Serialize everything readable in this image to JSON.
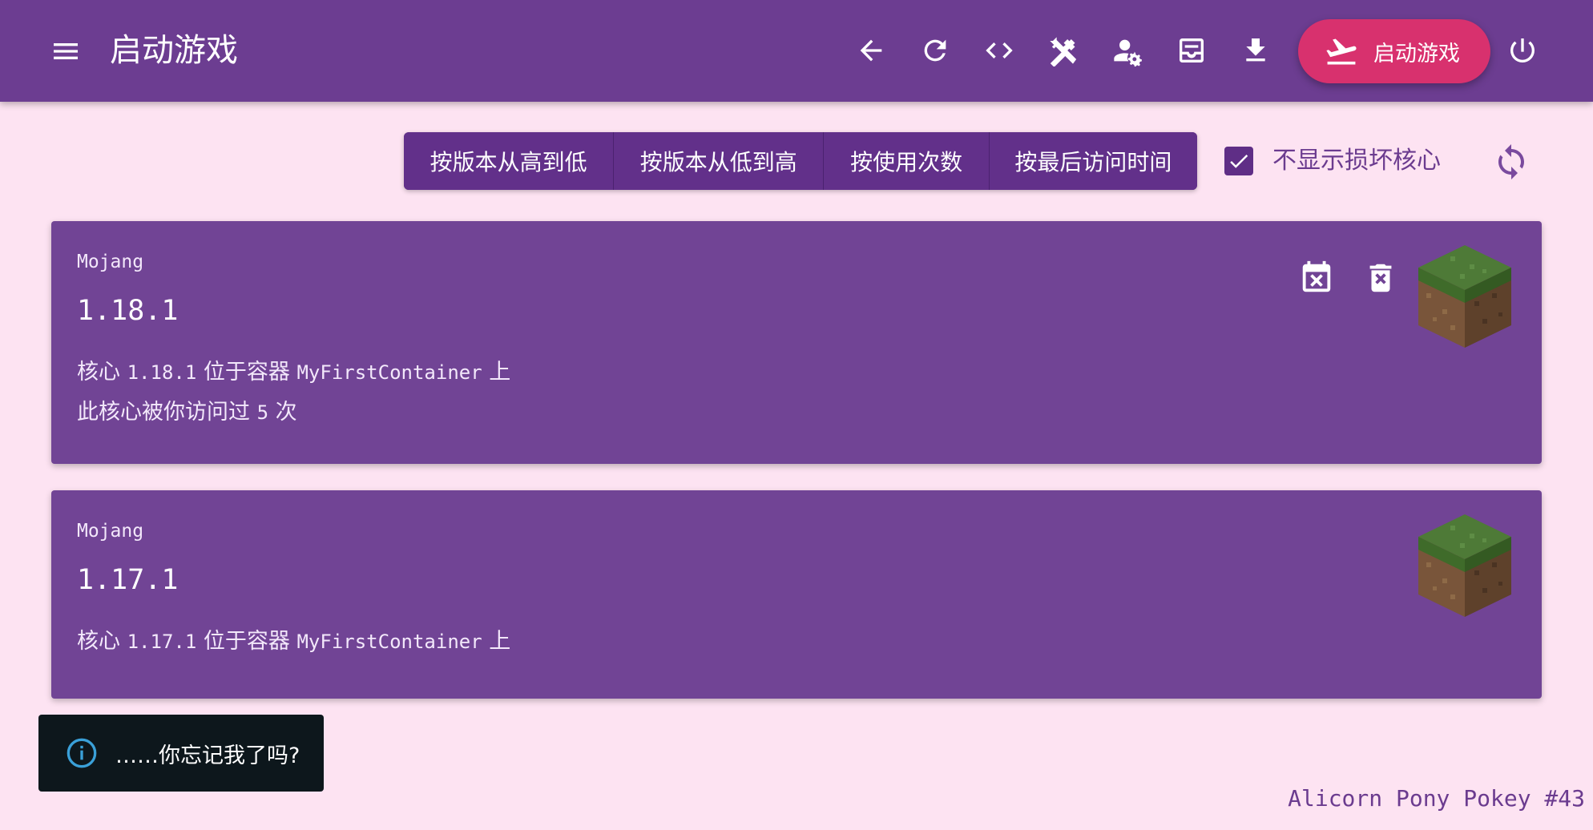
{
  "header": {
    "title": "启动游戏",
    "launch_label": "启动游戏",
    "icons": [
      "menu-icon",
      "arrow-back-icon",
      "refresh-icon",
      "code-icon",
      "tools-icon",
      "user-settings-icon",
      "inbox-icon",
      "download-icon",
      "flight-takeoff-icon",
      "power-icon"
    ]
  },
  "sort": {
    "buttons": [
      "按版本从高到低",
      "按版本从低到高",
      "按使用次数",
      "按最后访问时间"
    ]
  },
  "filter": {
    "hide_broken_label": "不显示损坏核心",
    "hide_broken_checked": true
  },
  "cores": [
    {
      "vendor": "Mojang",
      "version": "1.18.1",
      "location_prefix": "核心",
      "location_version": "1.18.1",
      "location_mid": "位于容器",
      "container": "MyFirstContainer",
      "location_suffix": "上",
      "visits_prefix": "此核心被你访问过",
      "visits_count": "5",
      "visits_suffix": "次",
      "icons": [
        "calendar-remove-icon",
        "delete-icon",
        "grass-block-icon"
      ]
    },
    {
      "vendor": "Mojang",
      "version": "1.17.1",
      "location_prefix": "核心",
      "location_version": "1.17.1",
      "location_mid": "位于容器",
      "container": "MyFirstContainer",
      "location_suffix": "上",
      "icons": [
        "grass-block-icon"
      ]
    }
  ],
  "toast": {
    "text": "……你忘记我了吗?"
  },
  "footer": {
    "version_text": "Alicorn Pony Pokey #43"
  },
  "colors": {
    "appbar": "#6c3d91",
    "accent": "#d8316e",
    "card": "#714495",
    "background": "#fde3f2",
    "toast": "#0d171c"
  }
}
